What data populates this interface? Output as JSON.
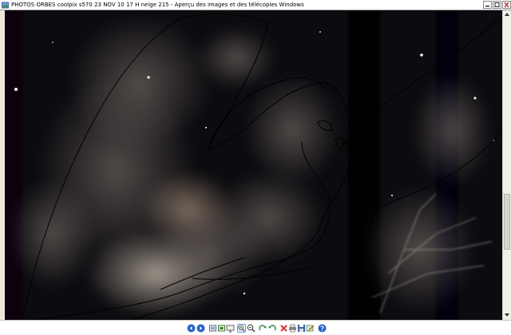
{
  "window": {
    "title": "PHOTOS ORBES  coolpix s570    23 NOV 10    17 H  neige 215 - Aperçu des images et des télécopies Windows"
  },
  "icons": {
    "app": "picture-viewer-icon",
    "minimize": "minimize-icon",
    "maximize": "maximize-icon",
    "close": "close-icon",
    "scroll_up": "arrow-up-icon",
    "scroll_down": "arrow-down-icon"
  },
  "toolbar": {
    "buttons": [
      {
        "name": "previous-image",
        "icon": "previous-icon"
      },
      {
        "name": "next-image",
        "icon": "next-icon"
      },
      {
        "name": "best-fit",
        "icon": "best-fit-icon"
      },
      {
        "name": "actual-size",
        "icon": "actual-size-icon"
      },
      {
        "name": "slideshow",
        "icon": "slideshow-icon"
      },
      {
        "name": "zoom-in",
        "icon": "zoom-in-icon"
      },
      {
        "name": "zoom-out",
        "icon": "zoom-out-icon"
      },
      {
        "name": "rotate-clockwise",
        "icon": "rotate-clockwise-icon"
      },
      {
        "name": "rotate-counterclockwise",
        "icon": "rotate-counterclockwise-icon"
      },
      {
        "name": "delete",
        "icon": "delete-icon"
      },
      {
        "name": "print",
        "icon": "print-icon"
      },
      {
        "name": "save-copy",
        "icon": "save-icon"
      },
      {
        "name": "open-editor",
        "icon": "edit-icon"
      },
      {
        "name": "help",
        "icon": "help-icon"
      }
    ]
  },
  "colors": {
    "photo_background": "#0b0a0d",
    "mist": "#c9bfb2",
    "drawing_lines": "#000000",
    "close_button": "#c0392b",
    "nav_button": "#2a62c9"
  }
}
